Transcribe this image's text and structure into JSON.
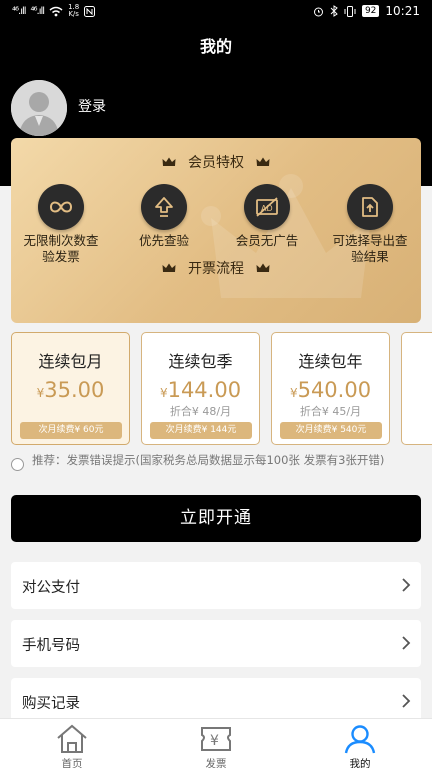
{
  "status_bar": {
    "signal1": "⁴⁶.ıll",
    "signal2": "⁴⁶.ıll",
    "net_speed_value": "1.8",
    "net_speed_unit": "K/s",
    "battery": "92",
    "time": "10:21"
  },
  "header": {
    "title": "我的"
  },
  "profile": {
    "login_label": "登录"
  },
  "vip": {
    "privileges_title": "会员特权",
    "flow_title": "开票流程",
    "benefits": [
      {
        "icon": "infinity-icon",
        "label_line1": "无限制次数查",
        "label_line2": "验发票"
      },
      {
        "icon": "priority-up-icon",
        "label_line1": "优先查验",
        "label_line2": ""
      },
      {
        "icon": "no-ads-icon",
        "label_line1": "会员无广告",
        "label_line2": ""
      },
      {
        "icon": "export-icon",
        "label_line1": "可选择导出查",
        "label_line2": "验结果"
      }
    ]
  },
  "plans": [
    {
      "name": "连续包月",
      "currency": "¥",
      "price": "35.00",
      "per_month": "",
      "renew": "次月续费¥ 60元",
      "selected": true
    },
    {
      "name": "连续包季",
      "currency": "¥",
      "price": "144.00",
      "per_month": "折合¥ 48/月",
      "renew": "次月续费¥ 144元",
      "selected": false
    },
    {
      "name": "连续包年",
      "currency": "¥",
      "price": "540.00",
      "per_month": "折合¥ 45/月",
      "renew": "次月续费¥ 540元",
      "selected": false
    }
  ],
  "recommend": {
    "text": "推荐：发票错误提示(国家税务总局数据显示每100张 发票有3张开错)"
  },
  "cta": {
    "label": "立即开通"
  },
  "menu": [
    {
      "label": "对公支付"
    },
    {
      "label": "手机号码"
    },
    {
      "label": "购买记录"
    }
  ],
  "tabs": [
    {
      "label": "首页",
      "icon": "home-icon",
      "active": false
    },
    {
      "label": "发票",
      "icon": "invoice-icon",
      "active": false
    },
    {
      "label": "我的",
      "icon": "user-icon",
      "active": true
    }
  ],
  "colors": {
    "gold": "#c99a55",
    "gold_chip": "#dcb77d",
    "active_tab": "#1a8cff",
    "header_bg": "#000000"
  }
}
